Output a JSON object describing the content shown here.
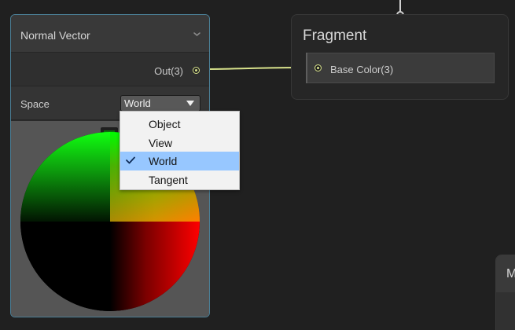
{
  "canvas": {
    "background": "#202020"
  },
  "normal_vector_node": {
    "title": "Normal Vector",
    "output_label": "Out(3)",
    "space_label": "Space",
    "space_value": "World",
    "header_icon": "chevron-down-icon",
    "preview_toggle_icon": "chevron-up-icon",
    "accent_color": "#4b7f96"
  },
  "space_dropdown": {
    "options": [
      {
        "label": "Object",
        "selected": false
      },
      {
        "label": "View",
        "selected": false
      },
      {
        "label": "World",
        "selected": true
      },
      {
        "label": "Tangent",
        "selected": false
      }
    ],
    "selected_color": "#97c7ff",
    "check_icon": "checkmark-icon"
  },
  "fragment_node": {
    "title": "Fragment",
    "slot_label": "Base Color(3)",
    "port_color": "#d9e38c"
  },
  "partial_node": {
    "title": "M"
  }
}
